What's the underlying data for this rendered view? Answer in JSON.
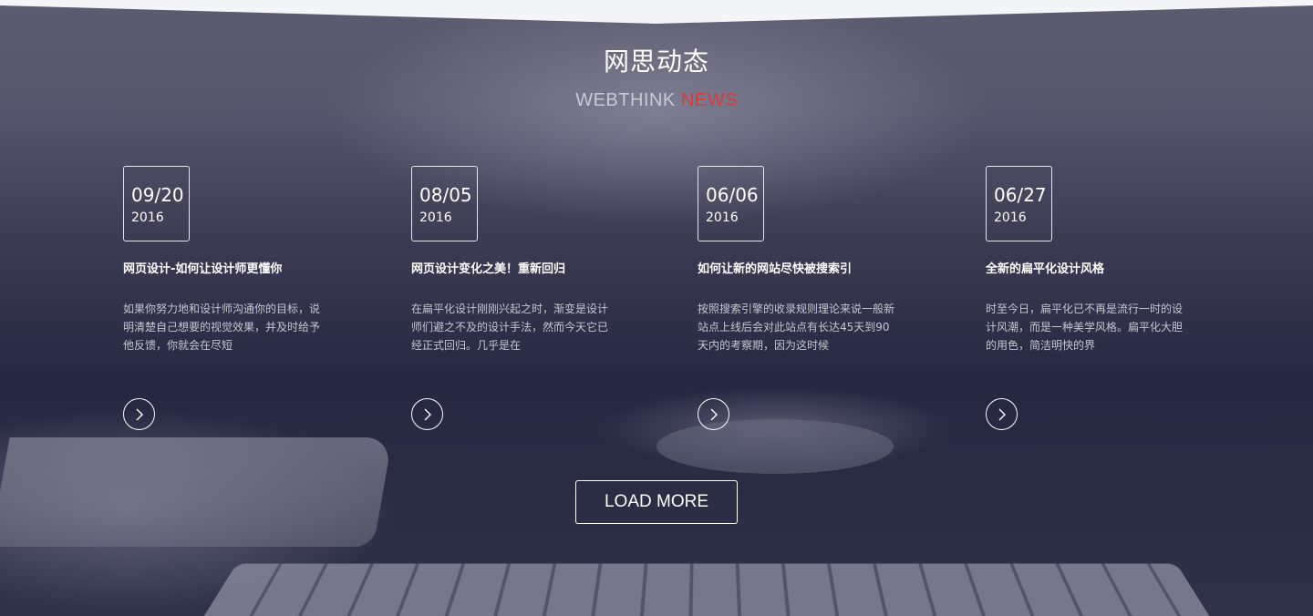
{
  "section": {
    "title": "网思动态",
    "subtitle_a": "WEBTHINK",
    "subtitle_b": "NEWS"
  },
  "colors": {
    "accent_red": "#d93a3a",
    "background": "#2b2c40",
    "text_white": "#ffffff"
  },
  "news": [
    {
      "date": "09/20",
      "year": "2016",
      "title": "网页设计-如何让设计师更懂你",
      "desc": "如果你努力地和设计师沟通你的目标，说明清楚自己想要的视觉效果，并及时给予他反馈，你就会在尽短",
      "arrow_icon": "chevron-right-icon"
    },
    {
      "date": "08/05",
      "year": "2016",
      "title": "网页设计变化之美！重新回归",
      "desc": "在扁平化设计刚刚兴起之时，渐变是设计师们避之不及的设计手法，然而今天它已经正式回归。几乎是在",
      "arrow_icon": "chevron-right-icon"
    },
    {
      "date": "06/06",
      "year": "2016",
      "title": "如何让新的网站尽快被搜索引",
      "desc": "按照搜索引擎的收录规则理论来说一般新站点上线后会对此站点有长达45天到90天内的考察期，因为这时候",
      "arrow_icon": "chevron-right-icon"
    },
    {
      "date": "06/27",
      "year": "2016",
      "title": "全新的扁平化设计风格",
      "desc": "时至今日，扁平化已不再是流行一时的设计风潮，而是一种美学风格。扁平化大胆的用色，简洁明快的界",
      "arrow_icon": "chevron-right-icon"
    }
  ],
  "load_more_label": "LOAD MORE"
}
